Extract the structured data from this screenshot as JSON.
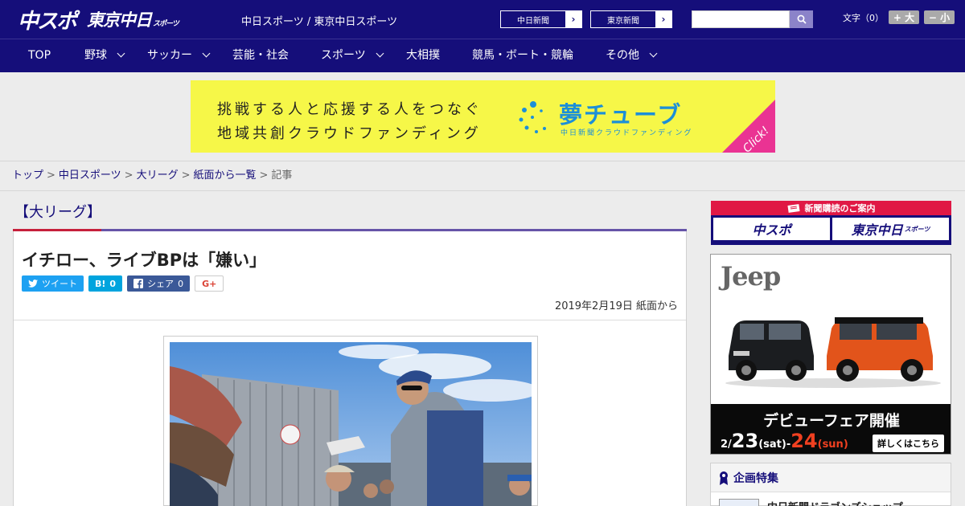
{
  "header": {
    "logo_main": "中スポ",
    "logo_tokyo": "東京中日",
    "logo_tokyo_small": "スポーツ",
    "tagline": "中日スポーツ / 東京中日スポーツ",
    "links": [
      {
        "label": "中日新聞"
      },
      {
        "label": "東京新聞"
      }
    ],
    "search_placeholder": "",
    "fontsize_label": "文字（0）",
    "fontsize_up": "+ 大",
    "fontsize_down": "− 小"
  },
  "nav": {
    "items": [
      {
        "label": "TOP",
        "dropdown": false
      },
      {
        "label": "野球",
        "dropdown": true
      },
      {
        "label": "サッカー",
        "dropdown": true
      },
      {
        "label": "芸能・社会",
        "dropdown": false
      },
      {
        "label": "スポーツ",
        "dropdown": true
      },
      {
        "label": "大相撲",
        "dropdown": false
      },
      {
        "label": "競馬・ボート・競輪",
        "dropdown": false
      },
      {
        "label": "その他",
        "dropdown": true
      }
    ]
  },
  "banner": {
    "line1": "挑戦する人と応援する人をつなぐ",
    "line2": "地域共創クラウドファンディング",
    "brand": "夢チューブ",
    "brand_sub": "中日新聞クラウドファンディング",
    "click": "Click!",
    "colors": {
      "bg": "#f6f748",
      "brand": "#1c8fd8",
      "click": "#ea3393"
    }
  },
  "breadcrumb": {
    "items": [
      "トップ",
      "中日スポーツ",
      "大リーグ",
      "紙面から一覧"
    ],
    "current": "記事",
    "separator": ">"
  },
  "article": {
    "category": "【大リーグ】",
    "headline": "イチロー、ライブBPは「嫌い」",
    "share": {
      "tweet": "ツイート",
      "hatena": "B!",
      "hatena_count": "0",
      "facebook": "シェア",
      "facebook_count": "0",
      "gplus": "G+"
    },
    "date": "2019年2月19日 紙面から"
  },
  "sidebar": {
    "subscription_title": "新聞購読のご案内",
    "sub_box1": "中スポ",
    "sub_box2": "東京中日",
    "sub_box2_small": "スポーツ",
    "ad": {
      "brand": "Jeep",
      "headline": "デビューフェア開催",
      "date_prefix": "2/",
      "date_start": "23",
      "date_start_day": "(sat)",
      "date_dash": "-",
      "date_end": "24",
      "date_end_day": "(sun)",
      "more": "詳しくはこちら"
    },
    "feature_title": "企画特集",
    "feature_item": "中日新聞ドラゴンズショップ"
  },
  "colors": {
    "header_bg": "#150e7a",
    "accent_red": "#c6203b",
    "accent_purple": "#6654a8"
  }
}
